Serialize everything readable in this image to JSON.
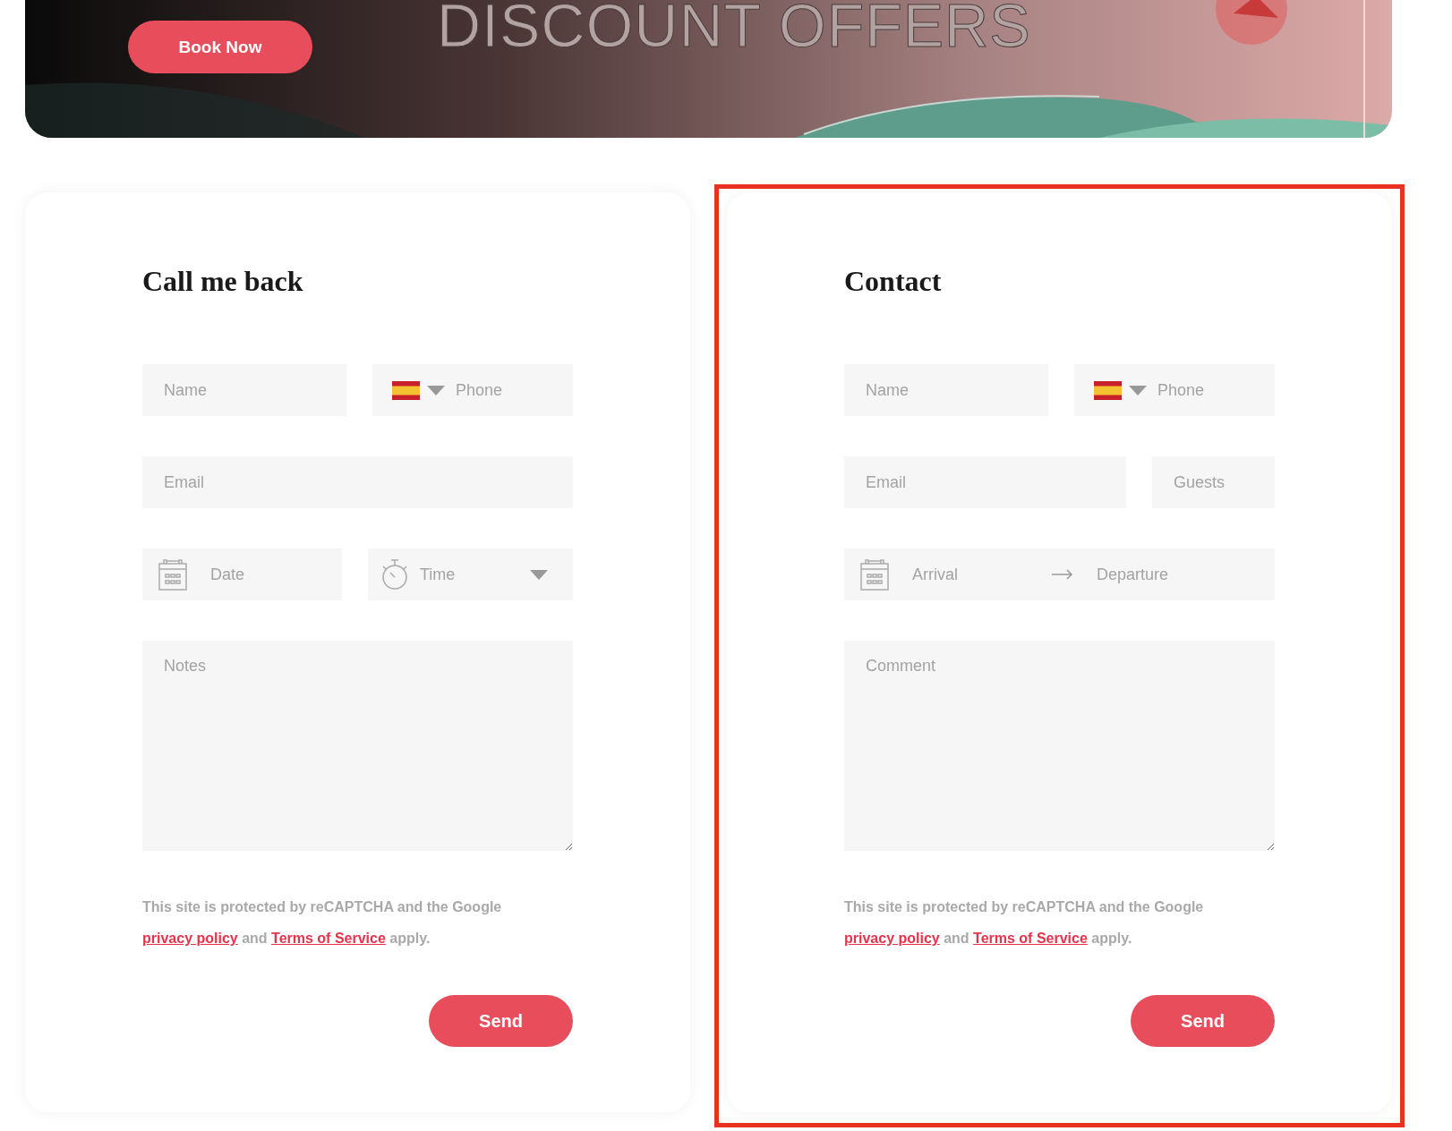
{
  "banner": {
    "heading": "DISCOUNT OFFERS",
    "button": "Book Now"
  },
  "forms": [
    {
      "title": "Call me back",
      "highlighted": false,
      "rows": [
        [
          {
            "kind": "text",
            "placeholder": "Name"
          },
          {
            "kind": "phone",
            "placeholder": "Phone"
          }
        ],
        [
          {
            "kind": "text",
            "placeholder": "Email"
          }
        ],
        [
          {
            "kind": "date",
            "placeholder": "Date"
          },
          {
            "kind": "time",
            "placeholder": "Time"
          }
        ],
        [
          {
            "kind": "textarea",
            "placeholder": "Notes"
          }
        ]
      ],
      "legal": {
        "before": "This site is protected by reCAPTCHA and the Google ",
        "link1": "privacy policy",
        "middle": " and ",
        "link2": "Terms of Service",
        "after": " apply."
      },
      "submit": "Send"
    },
    {
      "title": "Contact",
      "highlighted": true,
      "rows": [
        [
          {
            "kind": "text",
            "placeholder": "Name"
          },
          {
            "kind": "phone",
            "placeholder": "Phone"
          }
        ],
        [
          {
            "kind": "text",
            "placeholder": "Email"
          },
          {
            "kind": "small",
            "placeholder": "Guests"
          }
        ],
        [
          {
            "kind": "range",
            "placeholder": "Arrival",
            "placeholder2": "Departure"
          }
        ],
        [
          {
            "kind": "textarea",
            "placeholder": "Comment"
          }
        ]
      ],
      "legal": {
        "before": "This site is protected by reCAPTCHA and the Google ",
        "link1": "privacy policy",
        "middle": " and ",
        "link2": "Terms of Service",
        "after": " apply."
      },
      "submit": "Send"
    }
  ]
}
